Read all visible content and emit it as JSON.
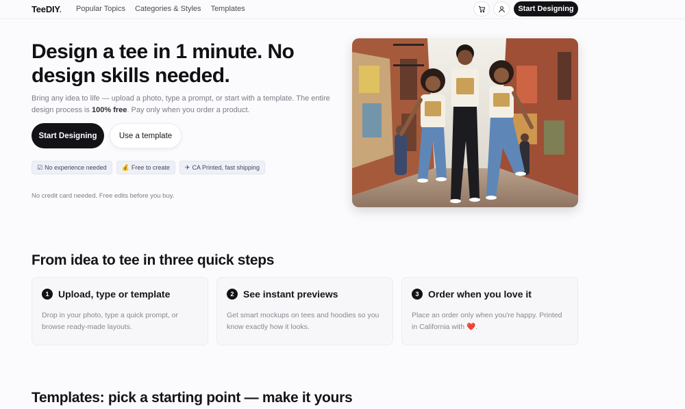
{
  "nav": {
    "logo_main": "TeeDIY",
    "logo_accent": ".",
    "links": [
      "Popular Topics",
      "Categories & Styles",
      "Templates"
    ],
    "cart_icon": "cart-icon",
    "user_icon": "user-icon",
    "cta": "Start Designing"
  },
  "hero": {
    "title": "Design a tee in 1 minute. No design skills needed.",
    "desc_before": "Bring any idea to life — upload a photo, type a prompt, or start with a template. The entire design process is ",
    "desc_bold": "100% free",
    "desc_after": ". Pay only when you order a product.",
    "primary_button": "Start Designing",
    "secondary_button": "Use a template",
    "badges": [
      {
        "icon": "☑",
        "label": "No experience needed"
      },
      {
        "icon": "💰",
        "label": "Free to create"
      },
      {
        "icon": "✈",
        "label": "CA Printed, fast shipping"
      }
    ],
    "note": "No credit card needed. Free edits before you buy."
  },
  "steps": {
    "title": "From idea to tee in three quick steps",
    "items": [
      {
        "num": "1",
        "title": "Upload, type or template",
        "desc": "Drop in your photo, type a quick prompt, or browse ready-made layouts."
      },
      {
        "num": "2",
        "title": "See instant previews",
        "desc": "Get smart mockups on tees and hoodies so you know exactly how it looks."
      },
      {
        "num": "3",
        "title": "Order when you love it",
        "desc": "Place an order only when you're happy. Printed in California with",
        "heart": "❤️",
        "desc_end": "."
      }
    ]
  },
  "templates": {
    "title": "Templates: pick a starting point — make it yours"
  },
  "colors": {
    "primary": "#121217",
    "accent": "#e04a3a",
    "badge_bg": "#eef0f7",
    "card_bg": "#f7f7f9"
  }
}
